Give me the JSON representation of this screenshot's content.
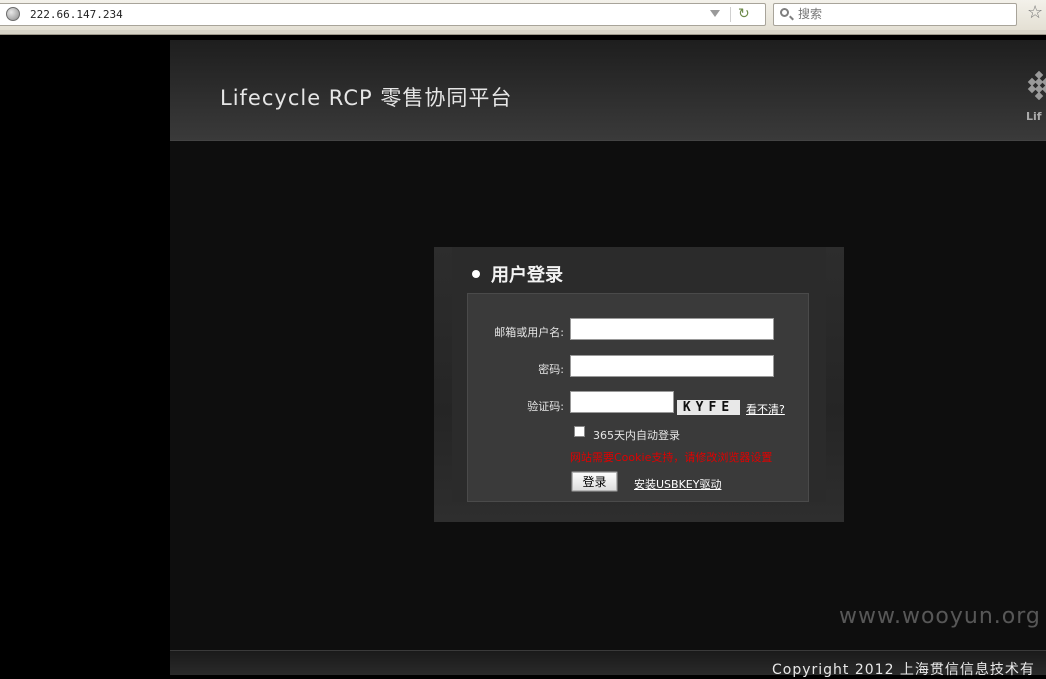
{
  "browser": {
    "url": "222.66.147.234",
    "search_placeholder": "搜索"
  },
  "header": {
    "title": "Lifecycle RCP 零售协同平台",
    "logo_text": "Lif"
  },
  "login": {
    "title": "用户登录",
    "username_label": "邮箱或用户名:",
    "password_label": "密码:",
    "captcha_label": "验证码:",
    "captcha_text": "KYFE",
    "captcha_refresh": "看不清?",
    "remember_label": "365天内自动登录",
    "cookie_warning": "网站需要Cookie支持，请修改浏览器设置",
    "submit_label": "登录",
    "usbkey_link": "安装USBKEY驱动"
  },
  "footer": {
    "copyright": "Copyright 2012 上海贯信信息技术有"
  },
  "watermark": "www.wooyun.org"
}
